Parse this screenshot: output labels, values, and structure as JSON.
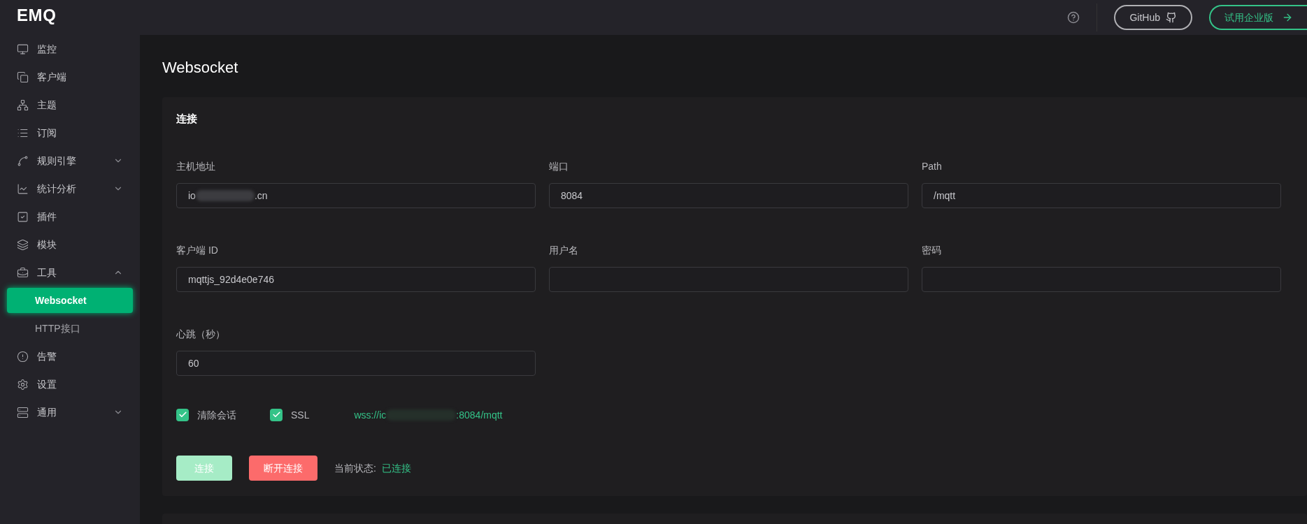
{
  "sidebar": {
    "logo": "EMQ",
    "items": [
      {
        "label": "监控",
        "selected": false
      },
      {
        "label": "客户端",
        "selected": false
      },
      {
        "label": "主题",
        "selected": false
      },
      {
        "label": "订阅",
        "selected": false
      },
      {
        "label": "规则引擎",
        "selected": false,
        "expanded": false
      },
      {
        "label": "统计分析",
        "selected": false,
        "expanded": false
      },
      {
        "label": "插件",
        "selected": false
      },
      {
        "label": "模块",
        "selected": false
      },
      {
        "label": "工具",
        "selected": false,
        "expanded": true,
        "children": [
          {
            "label": "Websocket",
            "selected": true
          },
          {
            "label": "HTTP接口",
            "selected": false
          }
        ]
      },
      {
        "label": "告警",
        "selected": false
      },
      {
        "label": "设置",
        "selected": false
      },
      {
        "label": "通用",
        "selected": false,
        "expanded": false
      }
    ]
  },
  "topbar": {
    "github": "GitHub",
    "trial": "试用企业版"
  },
  "page_title": "Websocket",
  "card": {
    "title": "连接",
    "fields": [
      {
        "label": "主机地址",
        "value_prefix": "io",
        "value_suffix": ".cn",
        "redacted": true
      },
      {
        "label": "端口",
        "value": "8084"
      },
      {
        "label": "Path",
        "value": "/mqtt"
      },
      {
        "label": "客户端 ID",
        "value": "mqttjs_92d4e0e746"
      },
      {
        "label": "用户名"
      },
      {
        "label": "密码"
      },
      {
        "label": "心跳（秒）",
        "value": "60"
      }
    ],
    "checkboxes": [
      {
        "label": "清除会话",
        "checked": true
      },
      {
        "label": "SSL",
        "checked": true
      }
    ],
    "url_prefix": "wss://ic",
    "url_suffix": ":8084/mqtt",
    "connect": "连接",
    "disconnect": "断开连接",
    "status_label": "当前状态:",
    "status": "已连接"
  }
}
